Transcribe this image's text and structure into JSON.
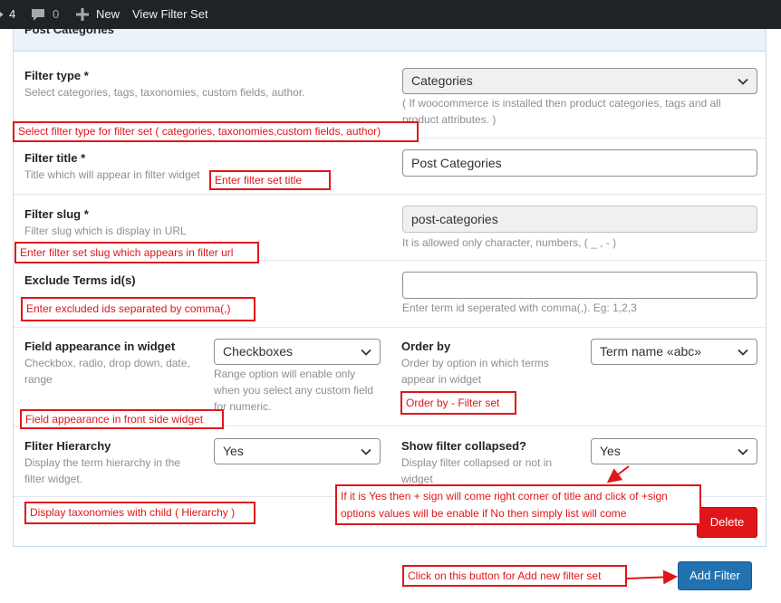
{
  "adminbar": {
    "update_count": "4",
    "comment_count": "0",
    "new_label": "New",
    "view_label": "View Filter Set"
  },
  "panel": {
    "title": "Post Categories"
  },
  "filter_type": {
    "label": "Filter type *",
    "desc": "Select categories, tags, taxonomies, custom fields, author.",
    "value": "Categories",
    "help_line1": "( If woocommerce is installed then product categories, tags and all",
    "help_line2": "product attributes. )"
  },
  "filter_title": {
    "label": "Filter title *",
    "desc": "Title which will appear in filter widget",
    "value": "Post Categories"
  },
  "filter_slug": {
    "label": "Filter slug *",
    "desc": "Filter slug which is display in URL",
    "value": "post-categories",
    "help": "It is allowed only character, numbers, ( _ , - )"
  },
  "exclude_terms": {
    "label": "Exclude Terms id(s)",
    "value": "",
    "help": "Enter term id seperated with comma(,). Eg: 1,2,3"
  },
  "field_appearance": {
    "label": "Field appearance in widget",
    "desc_line1": "Checkbox, radio, drop down, date,",
    "desc_line2": "range",
    "value": "Checkboxes",
    "help_line1": "Range option will enable only",
    "help_line2": "when you select any custom field",
    "help_line3": "for numeric."
  },
  "order_by": {
    "label": "Order by",
    "desc_line1": "Order by option in which terms",
    "desc_line2": "appear in widget",
    "value": "Term name «abc»"
  },
  "filter_hierarchy": {
    "label": "Fliter Hierarchy",
    "desc_line1": "Display the term hierarchy in the",
    "desc_line2": "filter widget.",
    "value": "Yes"
  },
  "show_collapsed": {
    "label": "Show filter collapsed?",
    "desc_line1": "Display filter collapsed or not in",
    "desc_line2": "widget",
    "value": "Yes"
  },
  "buttons": {
    "delete_label": "Delete",
    "add_filter_label": "Add Filter"
  },
  "annotations": {
    "filter_type": "Select filter type for filter set ( categories, taxonomies,custom fields, author)",
    "filter_title": "Enter filter set title",
    "filter_slug": "Enter filter set slug which appears in filter url",
    "exclude": "Enter excluded ids separated by comma(,)",
    "order_by": "Order by  - Filter set",
    "appearance": "Field appearance in front side widget",
    "hierarchy": "Display taxonomies with child ( Hierarchy )",
    "collapsed_line1": "If it is Yes then + sign will come right corner of title and click of +sign",
    "collapsed_line2": "options values will be enable if No then simply list will come",
    "add_filter": "Click on this button for Add new filter set"
  },
  "colors": {
    "annotation": "#e0161a",
    "delete_button": "#e0161a",
    "add_button": "#2271b1",
    "admin_bar": "#1d2327"
  }
}
